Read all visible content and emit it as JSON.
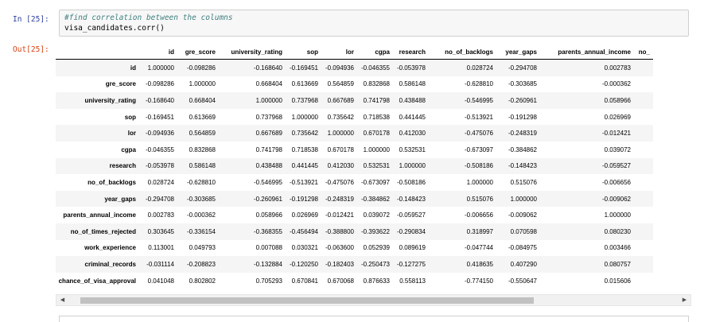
{
  "cell": {
    "in_prompt": "In [25]:",
    "out_prompt": "Out[25]:",
    "code_comment": "#find correlation between the columns",
    "code_line": "visa_candidates.corr()"
  },
  "table": {
    "columns": [
      "id",
      "gre_score",
      "university_rating",
      "sop",
      "lor",
      "cgpa",
      "research",
      "no_of_backlogs",
      "year_gaps",
      "parents_annual_income",
      "no_"
    ],
    "rows": [
      {
        "label": "id",
        "values": [
          "1.000000",
          "-0.098286",
          "-0.168640",
          "-0.169451",
          "-0.094936",
          "-0.046355",
          "-0.053978",
          "0.028724",
          "-0.294708",
          "0.002783",
          ""
        ]
      },
      {
        "label": "gre_score",
        "values": [
          "-0.098286",
          "1.000000",
          "0.668404",
          "0.613669",
          "0.564859",
          "0.832868",
          "0.586148",
          "-0.628810",
          "-0.303685",
          "-0.000362",
          ""
        ]
      },
      {
        "label": "university_rating",
        "values": [
          "-0.168640",
          "0.668404",
          "1.000000",
          "0.737968",
          "0.667689",
          "0.741798",
          "0.438488",
          "-0.546995",
          "-0.260961",
          "0.058966",
          ""
        ]
      },
      {
        "label": "sop",
        "values": [
          "-0.169451",
          "0.613669",
          "0.737968",
          "1.000000",
          "0.735642",
          "0.718538",
          "0.441445",
          "-0.513921",
          "-0.191298",
          "0.026969",
          ""
        ]
      },
      {
        "label": "lor",
        "values": [
          "-0.094936",
          "0.564859",
          "0.667689",
          "0.735642",
          "1.000000",
          "0.670178",
          "0.412030",
          "-0.475076",
          "-0.248319",
          "-0.012421",
          ""
        ]
      },
      {
        "label": "cgpa",
        "values": [
          "-0.046355",
          "0.832868",
          "0.741798",
          "0.718538",
          "0.670178",
          "1.000000",
          "0.532531",
          "-0.673097",
          "-0.384862",
          "0.039072",
          ""
        ]
      },
      {
        "label": "research",
        "values": [
          "-0.053978",
          "0.586148",
          "0.438488",
          "0.441445",
          "0.412030",
          "0.532531",
          "1.000000",
          "-0.508186",
          "-0.148423",
          "-0.059527",
          ""
        ]
      },
      {
        "label": "no_of_backlogs",
        "values": [
          "0.028724",
          "-0.628810",
          "-0.546995",
          "-0.513921",
          "-0.475076",
          "-0.673097",
          "-0.508186",
          "1.000000",
          "0.515076",
          "-0.006656",
          ""
        ]
      },
      {
        "label": "year_gaps",
        "values": [
          "-0.294708",
          "-0.303685",
          "-0.260961",
          "-0.191298",
          "-0.248319",
          "-0.384862",
          "-0.148423",
          "0.515076",
          "1.000000",
          "-0.009062",
          ""
        ]
      },
      {
        "label": "parents_annual_income",
        "values": [
          "0.002783",
          "-0.000362",
          "0.058966",
          "0.026969",
          "-0.012421",
          "0.039072",
          "-0.059527",
          "-0.006656",
          "-0.009062",
          "1.000000",
          ""
        ]
      },
      {
        "label": "no_of_times_rejected",
        "values": [
          "0.303645",
          "-0.336154",
          "-0.368355",
          "-0.456494",
          "-0.388800",
          "-0.393622",
          "-0.290834",
          "0.318997",
          "0.070598",
          "0.080230",
          ""
        ]
      },
      {
        "label": "work_experience",
        "values": [
          "0.113001",
          "0.049793",
          "0.007088",
          "0.030321",
          "-0.063600",
          "0.052939",
          "0.089619",
          "-0.047744",
          "-0.084975",
          "0.003466",
          ""
        ]
      },
      {
        "label": "criminal_records",
        "values": [
          "-0.031114",
          "-0.208823",
          "-0.132884",
          "-0.120250",
          "-0.182403",
          "-0.250473",
          "-0.127275",
          "0.418635",
          "0.407290",
          "0.080757",
          ""
        ]
      },
      {
        "label": "chance_of_visa_approval",
        "values": [
          "0.041048",
          "0.802802",
          "0.705293",
          "0.670841",
          "0.670068",
          "0.876633",
          "0.558113",
          "-0.774150",
          "-0.550647",
          "0.015606",
          ""
        ]
      }
    ]
  },
  "scrollbar": {
    "left_arrow": "◀",
    "right_arrow": "▶"
  }
}
